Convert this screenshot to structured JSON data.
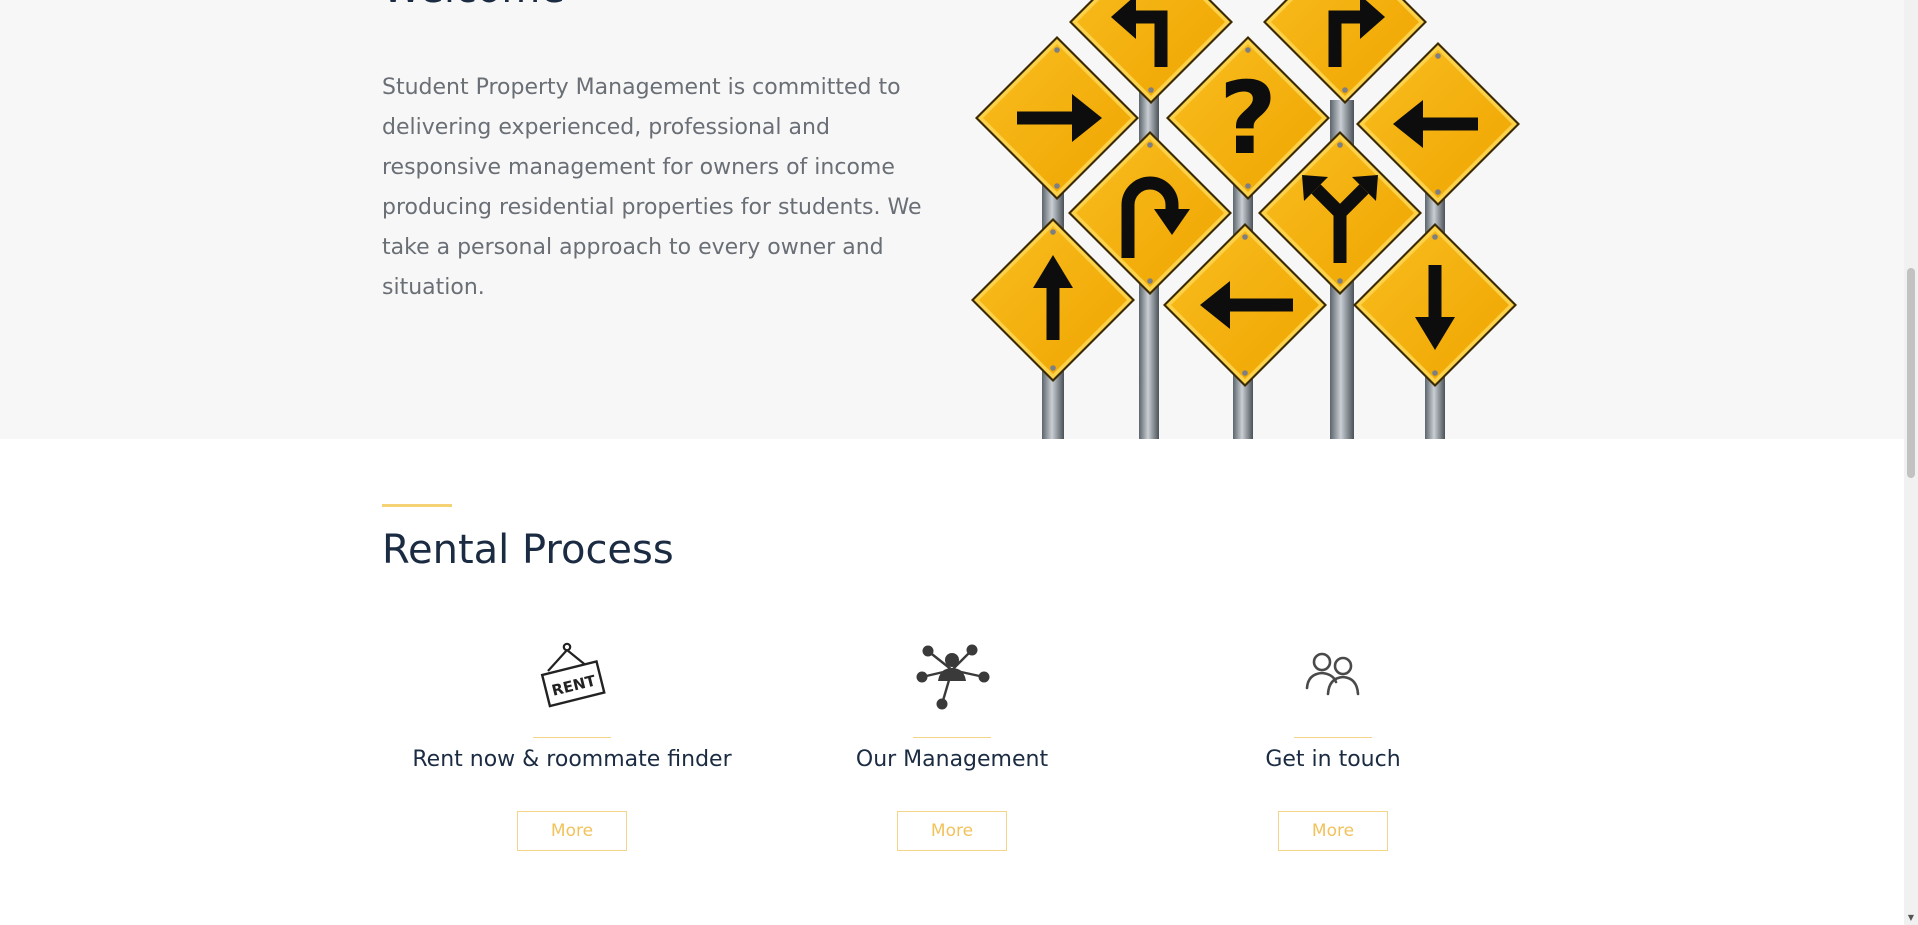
{
  "welcome": {
    "title": "Welcome",
    "text": "Student Property Management is committed to delivering experienced, professional and responsive management for owners of income producing residential properties for students. We take a personal approach to every owner and situation.",
    "image_icon": "road-signs-illustration"
  },
  "rental_process": {
    "title": "Rental Process",
    "accent_color": "#f6d277",
    "cards": [
      {
        "icon": "rent-sign-icon",
        "title": "Rent now & roommate finder",
        "button_label": "More"
      },
      {
        "icon": "network-icon",
        "title": "Our Management",
        "button_label": "More"
      },
      {
        "icon": "people-icon",
        "title": "Get in touch",
        "button_label": "More"
      }
    ]
  },
  "colors": {
    "sign_yellow": "#f5b00a",
    "heading": "#1b2b42",
    "body_text": "#6a6f76",
    "button_accent": "#f2c25b"
  }
}
